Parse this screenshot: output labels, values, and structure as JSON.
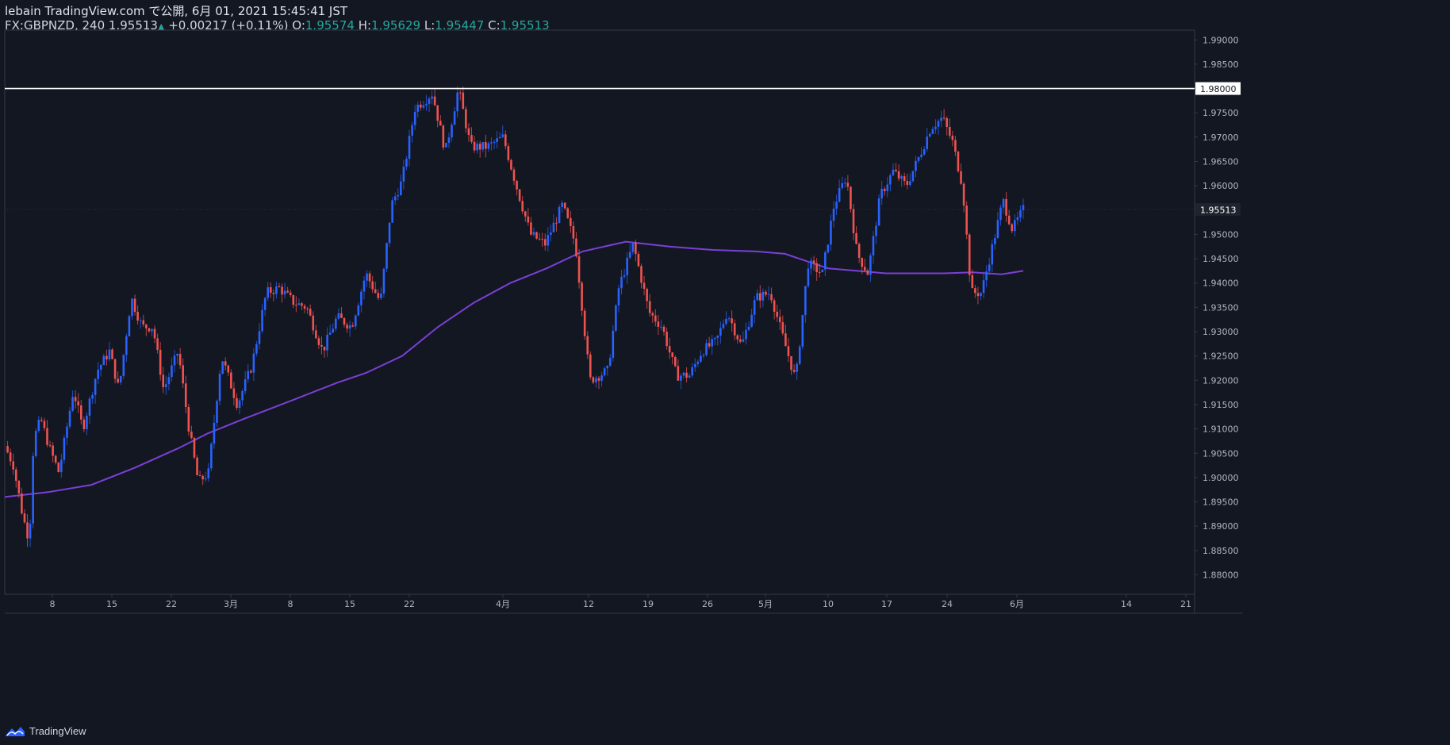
{
  "header": {
    "publish_line": "lebain TradingView.com で公開, 6月 01, 2021 15:45:41 JST",
    "symbol": "FX:GBPNZD, 240",
    "last_price": "1.95513",
    "change_arrow": "▲",
    "change": "+0.00217 (+0.11%)",
    "open_label": "O:",
    "open": "1.95574",
    "high_label": "H:",
    "high": "1.95629",
    "low_label": "L:",
    "low": "1.95447",
    "close_label": "C:",
    "close": "1.95513"
  },
  "footer": {
    "brand": "TradingView"
  },
  "colors": {
    "background": "#131722",
    "up_candle": "#2962ff",
    "down_candle": "#ef5350",
    "moving_average": "#7b3fd6",
    "horizontal_line": "#ffffff",
    "axis_text": "#b2b5be"
  },
  "chart_data": {
    "type": "candlestick",
    "symbol": "FX:GBPNZD",
    "timeframe": "240",
    "ylim": [
      1.876,
      1.992
    ],
    "y_ticks": [
      "1.99000",
      "1.98500",
      "1.98000",
      "1.97500",
      "1.97000",
      "1.96500",
      "1.96000",
      "1.95513",
      "1.95000",
      "1.94500",
      "1.94000",
      "1.93500",
      "1.93000",
      "1.92500",
      "1.92000",
      "1.91500",
      "1.91000",
      "1.90500",
      "1.90000",
      "1.89500",
      "1.89000",
      "1.88500",
      "1.88000"
    ],
    "x_ticks": [
      "8",
      "15",
      "22",
      "3月",
      "8",
      "15",
      "22",
      "4月",
      "12",
      "19",
      "26",
      "5月",
      "10",
      "17",
      "24",
      "6月",
      "14",
      "21"
    ],
    "horizontal_line": {
      "value": 1.98,
      "label": "1.98000"
    },
    "last_price_label": "1.95513",
    "price_path": [
      [
        0,
        1.9065
      ],
      [
        0.012,
        1.9025
      ],
      [
        0.025,
        1.892
      ],
      [
        0.034,
        1.887
      ],
      [
        0.04,
        1.908
      ],
      [
        0.05,
        1.912
      ],
      [
        0.062,
        1.906
      ],
      [
        0.075,
        1.901
      ],
      [
        0.095,
        1.918
      ],
      [
        0.108,
        1.91
      ],
      [
        0.128,
        1.922
      ],
      [
        0.145,
        1.926
      ],
      [
        0.158,
        1.918
      ],
      [
        0.175,
        1.937
      ],
      [
        0.19,
        1.931
      ],
      [
        0.205,
        1.931
      ],
      [
        0.22,
        1.918
      ],
      [
        0.24,
        1.926
      ],
      [
        0.255,
        1.91
      ],
      [
        0.268,
        1.899
      ],
      [
        0.282,
        1.901
      ],
      [
        0.3,
        1.925
      ],
      [
        0.322,
        1.915
      ],
      [
        0.342,
        1.923
      ],
      [
        0.362,
        1.938
      ],
      [
        0.38,
        1.939
      ],
      [
        0.4,
        1.936
      ],
      [
        0.418,
        1.935
      ],
      [
        0.44,
        1.926
      ],
      [
        0.46,
        1.933
      ],
      [
        0.48,
        1.931
      ],
      [
        0.5,
        1.942
      ],
      [
        0.52,
        1.936
      ],
      [
        0.535,
        1.956
      ],
      [
        0.55,
        1.961
      ],
      [
        0.568,
        1.976
      ],
      [
        0.592,
        1.979
      ],
      [
        0.61,
        1.967
      ],
      [
        0.628,
        1.98
      ],
      [
        0.645,
        1.968
      ],
      [
        0.668,
        1.968
      ],
      [
        0.69,
        1.97
      ],
      [
        0.71,
        1.959
      ],
      [
        0.728,
        1.95
      ],
      [
        0.748,
        1.948
      ],
      [
        0.772,
        1.956
      ],
      [
        0.79,
        1.948
      ],
      [
        0.81,
        1.92
      ],
      [
        0.835,
        1.922
      ],
      [
        0.85,
        1.939
      ],
      [
        0.87,
        1.948
      ],
      [
        0.892,
        1.934
      ],
      [
        0.91,
        1.931
      ],
      [
        0.93,
        1.921
      ],
      [
        0.948,
        1.921
      ],
      [
        0.965,
        1.926
      ],
      [
        0.985,
        1.928
      ],
      [
        1.0,
        1.934
      ],
      [
        1.02,
        1.927
      ],
      [
        1.04,
        1.937
      ],
      [
        1.06,
        1.938
      ],
      [
        1.075,
        1.93
      ],
      [
        1.095,
        1.92
      ],
      [
        1.112,
        1.944
      ],
      [
        1.132,
        1.942
      ],
      [
        1.148,
        1.956
      ],
      [
        1.165,
        1.962
      ],
      [
        1.18,
        1.946
      ],
      [
        1.195,
        1.942
      ],
      [
        1.212,
        1.958
      ],
      [
        1.23,
        1.963
      ],
      [
        1.248,
        1.96
      ],
      [
        1.266,
        1.966
      ],
      [
        1.282,
        1.972
      ],
      [
        1.298,
        1.974
      ],
      [
        1.312,
        1.969
      ],
      [
        1.326,
        1.96
      ],
      [
        1.338,
        1.938
      ],
      [
        1.352,
        1.938
      ],
      [
        1.368,
        1.948
      ],
      [
        1.382,
        1.957
      ],
      [
        1.395,
        1.951
      ],
      [
        1.41,
        1.9551
      ]
    ],
    "moving_average": [
      [
        0,
        1.896
      ],
      [
        0.06,
        1.897
      ],
      [
        0.12,
        1.8985
      ],
      [
        0.18,
        1.902
      ],
      [
        0.24,
        1.906
      ],
      [
        0.28,
        1.909
      ],
      [
        0.33,
        1.912
      ],
      [
        0.4,
        1.916
      ],
      [
        0.46,
        1.9195
      ],
      [
        0.5,
        1.9215
      ],
      [
        0.55,
        1.925
      ],
      [
        0.6,
        1.931
      ],
      [
        0.65,
        1.936
      ],
      [
        0.7,
        1.94
      ],
      [
        0.75,
        1.943
      ],
      [
        0.8,
        1.9465
      ],
      [
        0.86,
        1.9485
      ],
      [
        0.92,
        1.9475
      ],
      [
        0.98,
        1.9468
      ],
      [
        1.04,
        1.9465
      ],
      [
        1.08,
        1.946
      ],
      [
        1.1,
        1.945
      ],
      [
        1.14,
        1.943
      ],
      [
        1.18,
        1.9425
      ],
      [
        1.22,
        1.942
      ],
      [
        1.26,
        1.942
      ],
      [
        1.3,
        1.942
      ],
      [
        1.34,
        1.9422
      ],
      [
        1.38,
        1.9418
      ],
      [
        1.41,
        1.9425
      ]
    ]
  }
}
